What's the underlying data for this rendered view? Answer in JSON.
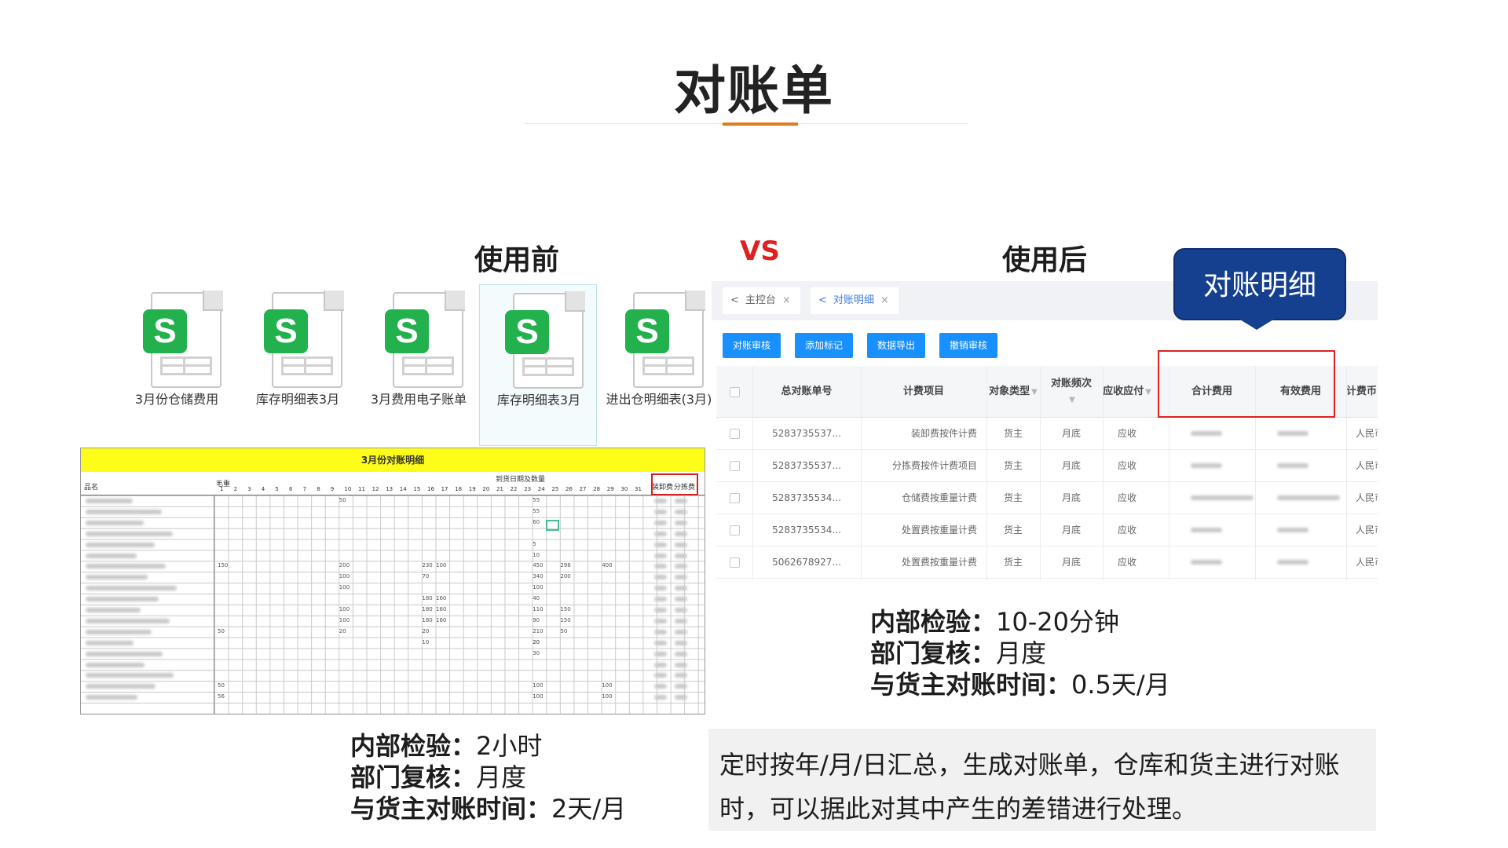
{
  "title": "对账单",
  "headings": {
    "before": "使用前",
    "vs": "VS",
    "after": "使用后"
  },
  "files": [
    {
      "name": "3月份仓储费用"
    },
    {
      "name": "库存明细表3月"
    },
    {
      "name": "3月费用电子账单"
    },
    {
      "name": "库存明细表3月"
    },
    {
      "name": "进出仓明细表(3月)"
    }
  ],
  "sheet": {
    "title": "3月份对账明细",
    "col_name": "品名",
    "col_weight": "毛重",
    "group_header": "到货日期及数量",
    "days": [
      "1",
      "2",
      "3",
      "4",
      "5",
      "6",
      "7",
      "8",
      "9",
      "10",
      "11",
      "12",
      "13",
      "14",
      "15",
      "16",
      "17",
      "18",
      "19",
      "20",
      "21",
      "22",
      "23",
      "24",
      "25",
      "26",
      "27",
      "28",
      "29",
      "30",
      "31"
    ],
    "fee_cols": [
      "装卸费",
      "分拣费"
    ],
    "sample_values": [
      "50",
      "55",
      "55",
      "60",
      "5",
      "10",
      "150",
      "200",
      "230",
      "100",
      "450",
      "298",
      "400",
      "100",
      "70",
      "340",
      "200",
      "100",
      "100",
      "180",
      "160",
      "40",
      "100",
      "180",
      "160",
      "110",
      "150",
      "100",
      "180",
      "160",
      "90",
      "150",
      "50",
      "20",
      "20",
      "210",
      "50",
      "10",
      "20",
      "20",
      "30",
      "50",
      "100",
      "100",
      "56",
      "100",
      "100"
    ]
  },
  "before_stats": [
    {
      "key": "内部检验：",
      "value": "2小时"
    },
    {
      "key": "部门复核：",
      "value": "月度"
    },
    {
      "key": "与货主对账时间：",
      "value": "2天/月"
    }
  ],
  "app": {
    "tabs": [
      {
        "label": "主控台"
      },
      {
        "label": "对账明细"
      }
    ],
    "buttons": [
      {
        "label": "对账审核"
      },
      {
        "label": "添加标记"
      },
      {
        "label": "数据导出"
      },
      {
        "label": "撤销审核"
      }
    ],
    "columns": [
      "总对账单号",
      "计费项目",
      "对象类型",
      "对账频次",
      "应收应付",
      "合计费用",
      "有效费用",
      "计费币"
    ],
    "rows": [
      {
        "id": "5283735537...",
        "item": "装卸费按件计费",
        "type": "货主",
        "freq": "月底",
        "dir": "应收",
        "currency": "人民币"
      },
      {
        "id": "5283735537...",
        "item": "分拣费按件计费项目",
        "type": "货主",
        "freq": "月底",
        "dir": "应收",
        "currency": "人民币"
      },
      {
        "id": "5283735534...",
        "item": "仓储费按重量计费",
        "type": "货主",
        "freq": "月底",
        "dir": "应收",
        "currency": "人民币"
      },
      {
        "id": "5283735534...",
        "item": "处置费按重量计费",
        "type": "货主",
        "freq": "月底",
        "dir": "应收",
        "currency": "人民币"
      },
      {
        "id": "5062678927...",
        "item": "处置费按重量计费",
        "type": "货主",
        "freq": "月底",
        "dir": "应收",
        "currency": "人民币"
      }
    ]
  },
  "callout": "对账明细",
  "after_stats": [
    {
      "key": "内部检验：",
      "value": "10-20分钟"
    },
    {
      "key": "部门复核：",
      "value": "月度"
    },
    {
      "key": "与货主对账时间：",
      "value": "0.5天/月"
    }
  ],
  "description": "定时按年/月/日汇总，生成对账单，仓库和货主进行对账时，可以据此对其中产生的差错进行处理。",
  "colors": {
    "accent": "#e07a1f",
    "vs": "#e02020",
    "button": "#1890ff",
    "callout": "#14408f",
    "sheet_header": "#fdfd19",
    "file_badge": "#23b14d"
  }
}
